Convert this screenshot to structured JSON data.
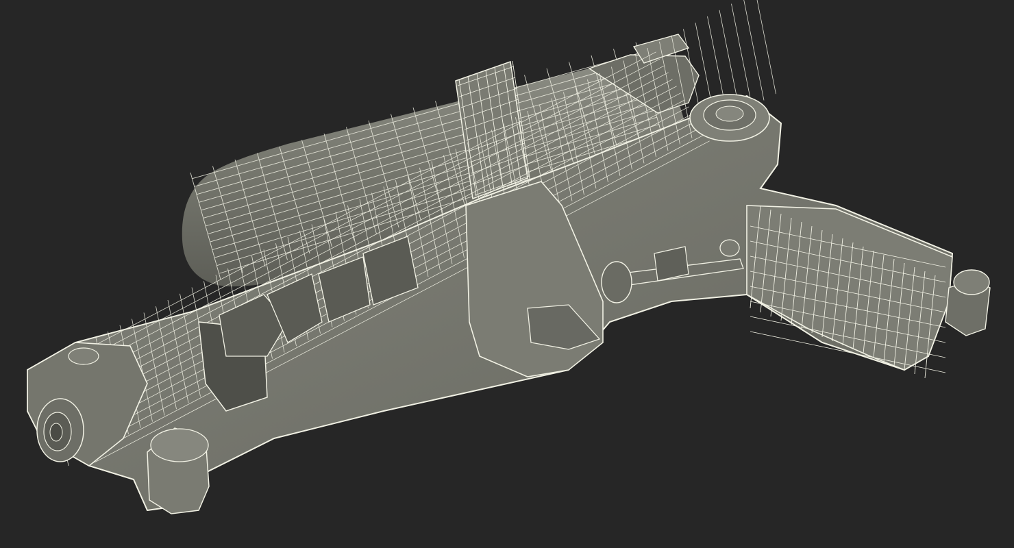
{
  "scene": {
    "background_color": "#262626",
    "model": {
      "subject": "water-gun",
      "render_style": "wireframe",
      "surface_color": "#74756c",
      "surface_dark_color": "#5b5c55",
      "wire_color": "#f1f1e4"
    }
  }
}
